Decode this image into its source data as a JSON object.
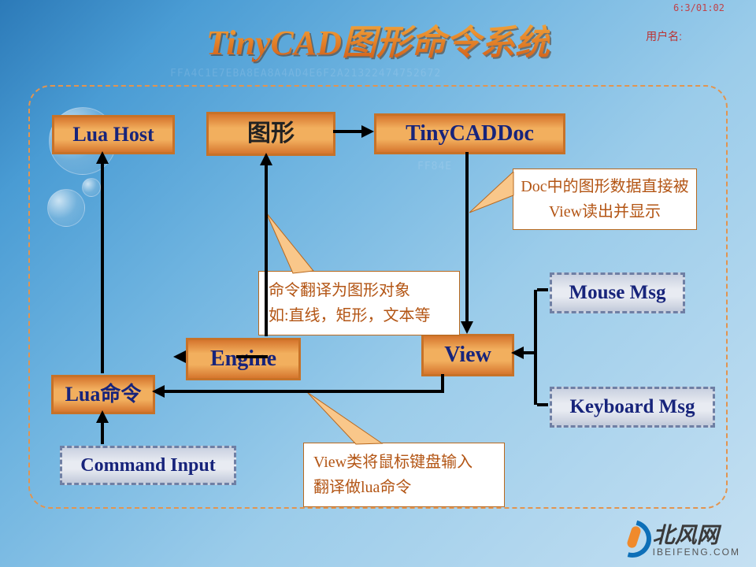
{
  "header": {
    "title": "TinyCAD图形命令系统",
    "user_label": "用户名:",
    "timestamp": "6:3/01:02"
  },
  "nodes": {
    "lua_host": "Lua Host",
    "shape": "图形",
    "doc": "TinyCADDoc",
    "engine": "Engine",
    "view": "View",
    "lua_cmd": "Lua命令"
  },
  "notes": {
    "doc_view": "Doc中的图形数据直接被View读出并显示",
    "cmd_translate_l1": "命令翻译为图形对象",
    "cmd_translate_l2": "如:直线，矩形，文本等",
    "view_translate_l1": "View类将鼠标键盘输入",
    "view_translate_l2": "翻译做lua命令"
  },
  "inputs": {
    "command_input": "Command Input",
    "mouse_msg": "Mouse Msg",
    "keyboard_msg": "Keyboard Msg"
  },
  "footer": {
    "brand_cn": "北风网",
    "brand_en": "IBEIFENG.COM"
  }
}
